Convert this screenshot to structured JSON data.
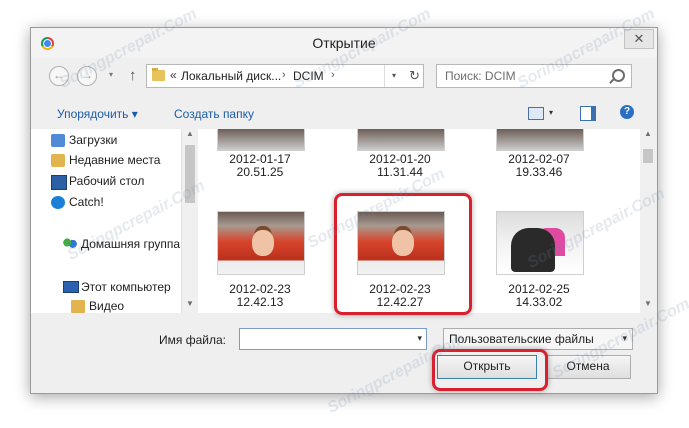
{
  "window": {
    "title": "Открытие",
    "close_glyph": "✕"
  },
  "nav": {
    "back_glyph": "←",
    "forward_glyph": "→",
    "dropdown_glyph": "▾",
    "up_glyph": "↑",
    "address": {
      "chevron": "«",
      "crumbs": [
        "Локальный диск...",
        "DCIM"
      ],
      "separator": "›",
      "dropdown_glyph": "▾",
      "refresh_glyph": "↻"
    },
    "search_placeholder": "Поиск: DCIM"
  },
  "toolbar": {
    "organize_label": "Упорядочить ▾",
    "new_folder_label": "Создать папку",
    "view_dropdown_glyph": "▾",
    "help_glyph": "?"
  },
  "sidebar": {
    "items": [
      {
        "label": "Загрузки",
        "icon": "downloads-icon"
      },
      {
        "label": "Недавние места",
        "icon": "recent-places-icon"
      },
      {
        "label": "Рабочий стол",
        "icon": "desktop-icon"
      },
      {
        "label": "Catch!",
        "icon": "catch-icon"
      },
      {
        "label": "Домашняя группа",
        "icon": "homegroup-icon"
      },
      {
        "label": "Этот компьютер",
        "icon": "computer-icon"
      },
      {
        "label": "Видео",
        "icon": "video-folder-icon"
      }
    ]
  },
  "files": [
    {
      "date": "2012-01-17",
      "time": "20.51.25"
    },
    {
      "date": "2012-01-20",
      "time": "11.31.44"
    },
    {
      "date": "2012-02-07",
      "time": "19.33.46"
    },
    {
      "date": "2012-02-23",
      "time": "12.42.13"
    },
    {
      "date": "2012-02-23",
      "time": "12.42.27",
      "highlighted": true
    },
    {
      "date": "2012-02-25",
      "time": "14.33.02"
    }
  ],
  "footer": {
    "filename_label": "Имя файла:",
    "filename_value": "",
    "filter_value": "Пользовательские файлы",
    "open_label": "Открыть",
    "cancel_label": "Отмена"
  },
  "scroll_glyphs": {
    "up": "▲",
    "down": "▼"
  },
  "watermark": "Soringpcrepair.Com",
  "colors": {
    "highlight": "#d8202e",
    "link": "#1b5ca8",
    "accent": "#2b6fc5"
  }
}
